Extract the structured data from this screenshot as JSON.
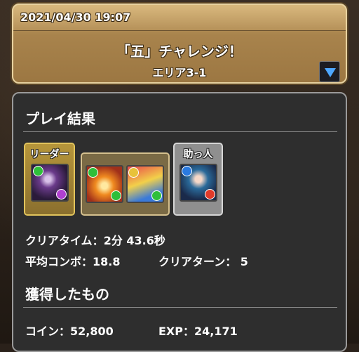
{
  "header": {
    "date": "2021/04/30 19:07",
    "title": "「五」チャレンジ！",
    "area": "エリア3-1",
    "dropdown_icon": "triangle-down-icon",
    "colors": {
      "dropdown_arrow": "#4ea8ff",
      "header_gold": "#b69159"
    }
  },
  "results": {
    "section_title": "プレイ結果",
    "leader_label": "リーダー",
    "helper_label": "助っ人",
    "clear_time_label": "クリアタイム：",
    "clear_time_value": "2分 43.6秒",
    "avg_combo_label": "平均コンボ：",
    "avg_combo_value": "18.8",
    "clear_turn_label": "クリアターン：",
    "clear_turn_value": "5"
  },
  "rewards": {
    "section_title": "獲得したもの",
    "coin_label": "コイン：",
    "coin_value": "52,800",
    "exp_label": "EXP：",
    "exp_value": "24,171"
  }
}
